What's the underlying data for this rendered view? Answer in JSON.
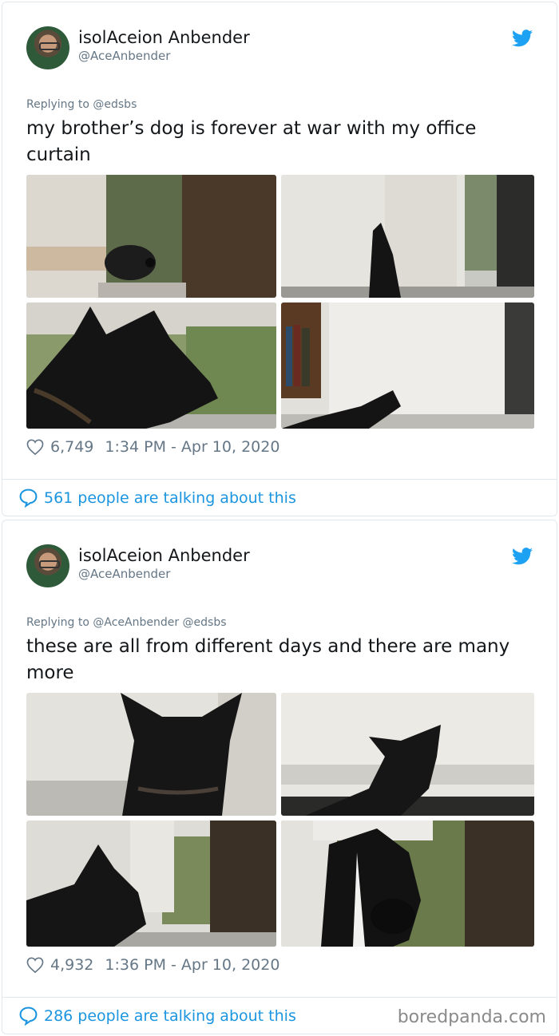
{
  "tweets": [
    {
      "author": "isolAceion Anbender",
      "handle": "@AceAnbender",
      "replying_prefix": "Replying to",
      "replying_to": "@edsbs",
      "text": "my brother’s dog is forever at war with my office curtain",
      "likes": "6,749",
      "timestamp": "1:34 PM - Apr 10, 2020",
      "talking": "561 people are talking about this"
    },
    {
      "author": "isolAceion Anbender",
      "handle": "@AceAnbender",
      "replying_prefix": "Replying to",
      "replying_to": "@AceAnbender @edsbs",
      "text": "these are all from different days and there are many more",
      "likes": "4,932",
      "timestamp": "1:36 PM - Apr 10, 2020",
      "talking": "286 people are talking about this"
    }
  ],
  "watermark": "boredpanda.com",
  "icons": {
    "bird": "twitter-bird-icon",
    "heart": "heart-icon",
    "bubble": "speech-bubble-icon"
  },
  "colors": {
    "link_blue": "#1b95e0",
    "twitter_blue": "#1da1f2",
    "secondary_text": "#657786",
    "border": "#e1e8ed"
  }
}
